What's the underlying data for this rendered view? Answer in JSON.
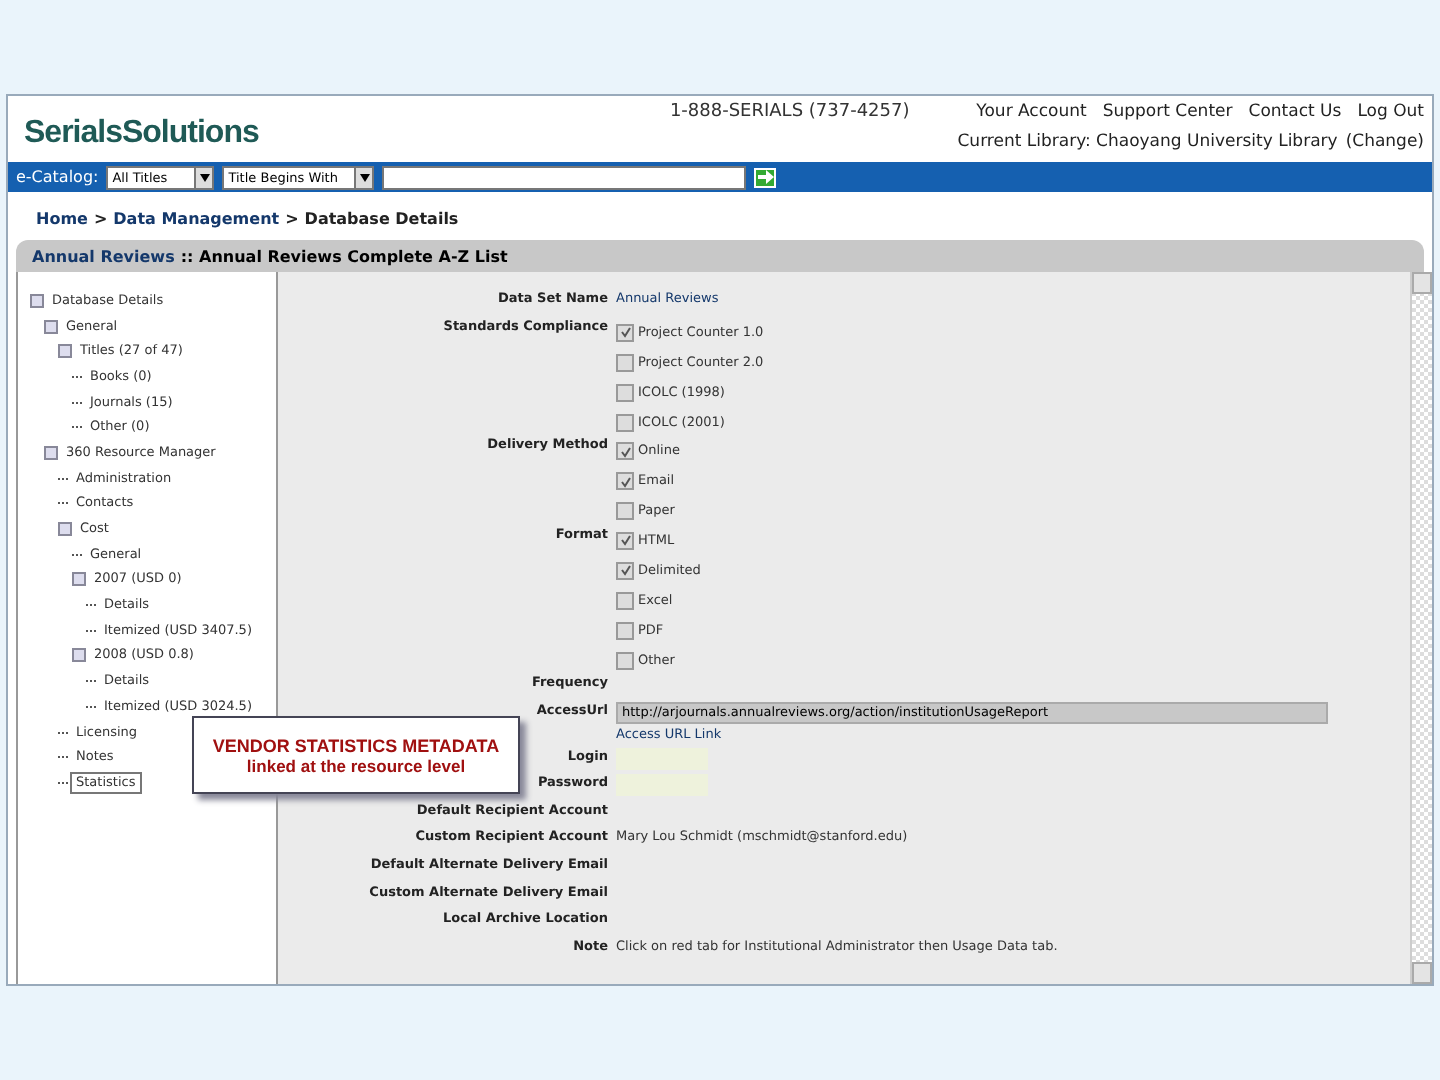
{
  "header": {
    "logo": "SerialsSolutions",
    "phone": "1-888-SERIALS (737-4257)",
    "links": [
      "Your Account",
      "Support Center",
      "Contact Us",
      "Log Out"
    ],
    "library": "Current Library: Chaoyang University Library",
    "change": "(Change)"
  },
  "search_bar": {
    "label": "e-Catalog:",
    "scope": "All Titles",
    "match": "Title Begins With"
  },
  "breadcrumb": {
    "separator": ">",
    "items": [
      "Home",
      "Data Management",
      "Database Details"
    ]
  },
  "title_bar": {
    "provider": "Annual Reviews",
    "database": ":: Annual Reviews Complete A-Z List"
  },
  "tree": [
    {
      "label": "Database Details",
      "expanded": true,
      "selected": false,
      "children": [
        {
          "label": "General",
          "expanded": true,
          "selected": false,
          "children": [
            {
              "label": "Titles (27 of 47)",
              "expanded": true,
              "selected": false,
              "children": [
                {
                  "label": "Books (0)",
                  "selected": false
                },
                {
                  "label": "Journals (15)",
                  "selected": false
                },
                {
                  "label": "Other (0)",
                  "selected": false
                }
              ]
            }
          ]
        },
        {
          "label": "360 Resource Manager",
          "expanded": true,
          "selected": false,
          "children": [
            {
              "label": "Administration",
              "selected": false
            },
            {
              "label": "Contacts",
              "selected": false
            },
            {
              "label": "Cost",
              "expanded": true,
              "selected": false,
              "children": [
                {
                  "label": "General",
                  "selected": false
                },
                {
                  "label": "2007 (USD 0)",
                  "expanded": true,
                  "selected": false,
                  "children": [
                    {
                      "label": "Details",
                      "selected": false
                    },
                    {
                      "label": "Itemized (USD 3407.5)",
                      "selected": false
                    }
                  ]
                },
                {
                  "label": "2008 (USD 0.8)",
                  "expanded": true,
                  "selected": false,
                  "children": [
                    {
                      "label": "Details",
                      "selected": false
                    },
                    {
                      "label": "Itemized (USD 3024.5)",
                      "selected": false
                    }
                  ]
                }
              ]
            },
            {
              "label": "Licensing",
              "selected": false
            },
            {
              "label": "Notes",
              "selected": false
            },
            {
              "label": "Statistics",
              "selected": true
            }
          ]
        }
      ]
    }
  ],
  "callout": {
    "title": "VENDOR STATISTICS METADATA",
    "subtitle": "linked at the resource level"
  },
  "form": [
    {
      "label": "Data Set Name",
      "kind": "link",
      "value": "Annual Reviews"
    },
    {
      "label": "Standards Compliance",
      "kind": "checks",
      "options": [
        {
          "label": "Project Counter 1.0",
          "checked": true
        },
        {
          "label": "Project Counter 2.0",
          "checked": false
        },
        {
          "label": "ICOLC (1998)",
          "checked": false
        },
        {
          "label": "ICOLC (2001)",
          "checked": false
        }
      ]
    },
    {
      "label": "Delivery Method",
      "kind": "checks",
      "options": [
        {
          "label": "Online",
          "checked": true
        },
        {
          "label": "Email",
          "checked": true
        },
        {
          "label": "Paper",
          "checked": false
        }
      ]
    },
    {
      "label": "Format",
      "kind": "checks",
      "options": [
        {
          "label": "HTML",
          "checked": true
        },
        {
          "label": "Delimited",
          "checked": true
        },
        {
          "label": "Excel",
          "checked": false
        },
        {
          "label": "PDF",
          "checked": false
        },
        {
          "label": "Other",
          "checked": false
        }
      ]
    },
    {
      "label": "Frequency",
      "kind": "text"
    },
    {
      "label": "AccessUrl",
      "kind": "url",
      "value": "http://arjournals.annualreviews.org/action/institutionUsageReport",
      "link": "Access URL Link"
    },
    {
      "label": "Login",
      "kind": "secret"
    },
    {
      "label": "Password",
      "kind": "secret"
    },
    {
      "label": "Default Recipient Account",
      "kind": "text"
    },
    {
      "label": "Custom Recipient Account",
      "kind": "text",
      "value": "Mary Lou Schmidt (mschmidt@stanford.edu)"
    },
    {
      "label": "Default Alternate Delivery Email",
      "kind": "text"
    },
    {
      "label": "Custom Alternate Delivery Email",
      "kind": "text"
    },
    {
      "label": "Local Archive Location",
      "kind": "text"
    },
    {
      "label": "Note",
      "kind": "text",
      "value": "Click on red tab for Institutional Administrator then Usage Data tab."
    }
  ]
}
